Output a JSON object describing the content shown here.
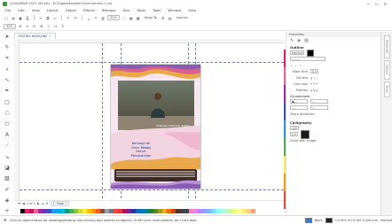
{
  "window": {
    "title": "CorelDRAW 2021 (64-bit) - D:\\Tugas\\Majalah\\Cover\\sampul 1.cdr",
    "minimize": "—",
    "maximize": "☐",
    "close": "✕"
  },
  "menu": [
    "File",
    "Edit",
    "View",
    "Layout",
    "Object",
    "Effects",
    "Bitmaps",
    "Text",
    "Table",
    "Tools",
    "Window",
    "Help"
  ],
  "toolbar": {
    "zoom": "32%",
    "snap_to": "Snap To",
    "launch": "Launch"
  },
  "propbar": {
    "zoom_value": "32%"
  },
  "document_tab": {
    "label": "EDITING MAGAZINE",
    "add": "+"
  },
  "page_content": {
    "photo_caption": "Prabowo Pratomo, S.Kom.",
    "headline_lines": [
      "Datanglah",
      "Jika Mampu",
      "Untuk",
      "Pendidikan"
    ]
  },
  "page_nav": {
    "counter": "1 of 1",
    "page_tab": "1: Page 1"
  },
  "docker": {
    "header": "Properties",
    "section_outline": "Outline",
    "hairline": "Hairline",
    "width_label": "Miter limit",
    "miter_value": "5.0",
    "corners_label": "Corners",
    "line_caps_label": "Line caps",
    "position_label": "Position",
    "arrowheads": "Arrowheads",
    "share_attributes": "Share Attributes",
    "calligraphy": "Calligraphy",
    "stretch_value": "100",
    "angle_value": "0.0",
    "scale_with_image": "Scale with image",
    "dock_tabs": [
      "Properties",
      "Objects",
      "Hints"
    ]
  },
  "palette_colors": [
    "#ffffff",
    "#000000",
    "#e91e63",
    "#c2185b",
    "#f06292",
    "#9c27b0",
    "#673ab7",
    "#3f51b5",
    "#2196f3",
    "#03a9f4",
    "#00bcd4",
    "#009688",
    "#4caf50",
    "#8bc34a",
    "#cddc39",
    "#ffeb3b",
    "#ffc107",
    "#ff9800",
    "#ff5722",
    "#795548",
    "#9e9e9e",
    "#607d8b",
    "#f44336",
    "#e53935",
    "#ad1457",
    "#7b1fa2",
    "#283593",
    "#1565c0",
    "#0277bd",
    "#00838f",
    "#2e7d32",
    "#558b2f",
    "#9e9d24",
    "#f9a825",
    "#ef6c00",
    "#d84315",
    "#4e342e",
    "#424242",
    "#37474f",
    "#ff80ab",
    "#ea80fc",
    "#b388ff",
    "#8c9eff",
    "#82b1ff",
    "#80d8ff",
    "#84ffff",
    "#a7ffeb",
    "#b9f6ca",
    "#ccff90",
    "#f4ff81",
    "#ffff8d",
    "#ffe57f",
    "#ffd180",
    "#ff9e80"
  ],
  "statusbar": {
    "message": "Click an object twice for rotating/skewing; dbl-clicking tool selects all objects; Shift+click multi-selects; Alt+click digs",
    "fill_label": "None",
    "color_info": "C:0 M:0 Y:0 K:100  0.200 mm",
    "outline_label": "Hairline"
  }
}
